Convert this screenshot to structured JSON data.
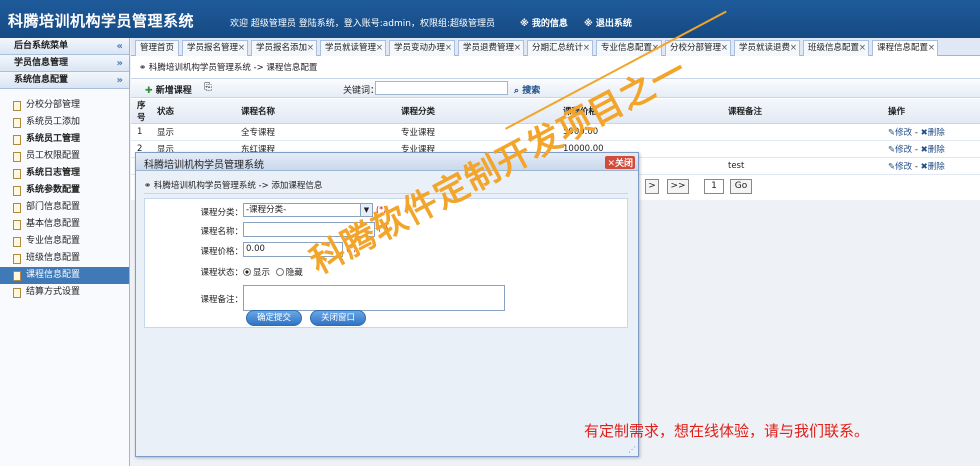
{
  "app_title": "科腾培训机构学员管理系统",
  "header": {
    "welcome_text": "欢迎  超级管理员  登陆系统，登入账号:admin，权限组:超级管理员",
    "my_info": "※  我的信息",
    "logout": "※  退出系统"
  },
  "sidebar": {
    "sections": [
      {
        "label": "后台系统菜单",
        "chevron": "«"
      },
      {
        "label": "学员信息管理",
        "chevron": "»"
      },
      {
        "label": "系统信息配置",
        "chevron": "»"
      }
    ],
    "items": [
      {
        "label": "分校分部管理"
      },
      {
        "label": "系统员工添加"
      },
      {
        "label": "系统员工管理"
      },
      {
        "label": "员工权限配置"
      },
      {
        "label": "系统日志管理"
      },
      {
        "label": "系统参数配置"
      },
      {
        "label": "部门信息配置"
      },
      {
        "label": "基本信息配置"
      },
      {
        "label": "专业信息配置"
      },
      {
        "label": "班级信息配置"
      },
      {
        "label": "课程信息配置"
      },
      {
        "label": "结算方式设置"
      }
    ]
  },
  "tabs": [
    {
      "label": "管理首页"
    },
    {
      "label": "学员报名管理"
    },
    {
      "label": "学员报名添加"
    },
    {
      "label": "学员就读管理"
    },
    {
      "label": "学员变动办理"
    },
    {
      "label": "学员退费管理"
    },
    {
      "label": "分期汇总统计"
    },
    {
      "label": "专业信息配置"
    },
    {
      "label": "分校分部管理"
    },
    {
      "label": "学员就读退费"
    },
    {
      "label": "班级信息配置"
    },
    {
      "label": "课程信息配置"
    }
  ],
  "content": {
    "breadcrumb": "科腾培训机构学员管理系统 -> 课程信息配置",
    "add_button": "新增课程",
    "keyword_label": "关键词：",
    "search_button": "搜索",
    "table": {
      "headers": [
        "序号",
        "状态",
        "课程名称",
        "课程分类",
        "课程价格",
        "课程备注",
        "操作"
      ],
      "rows": [
        {
          "no": "1",
          "status": "显示",
          "name": "全专课程",
          "category": "专业课程",
          "price": "5000.00",
          "remark": ""
        },
        {
          "no": "2",
          "status": "显示",
          "name": "东红课程",
          "category": "专业课程",
          "price": "10000.00",
          "remark": ""
        },
        {
          "no": "",
          "status": "",
          "name": "",
          "category": "",
          "price": "",
          "remark": "test"
        }
      ],
      "edit_label": "修改",
      "delete_label": "删除",
      "sep": "-"
    },
    "pager": {
      "next": ">",
      "last": ">>",
      "page": "1",
      "go": "Go"
    }
  },
  "dialog": {
    "title": "科腾培训机构学员管理系统",
    "close_label": "关闭",
    "breadcrumb": "科腾培训机构学员管理系统 -> 添加课程信息",
    "fields": {
      "category_label": "课程分类：",
      "category_value": "-课程分类-",
      "name_label": "课程名称：",
      "price_label": "课程价格：",
      "price_value": "0.00",
      "status_label": "课程状态：",
      "status_show": "显示",
      "status_hide": "隐藏",
      "remark_label": "课程备注：",
      "required_mark": "(*)"
    },
    "submit_label": "确定提交",
    "close_window_label": "关闭窗口"
  },
  "watermark": "科腾软件定制开发项目之一",
  "promo": "有定制需求，想在线体验，请与我们联系。"
}
